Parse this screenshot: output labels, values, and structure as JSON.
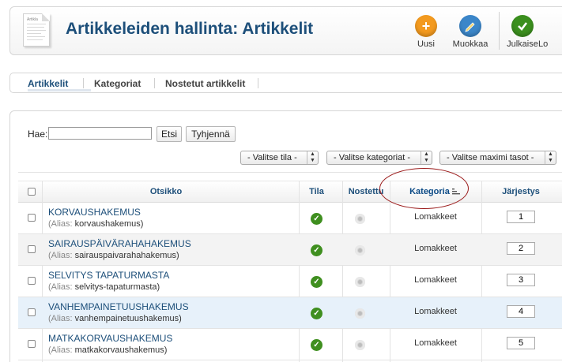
{
  "header": {
    "title": "Artikkeleiden hallinta: Artikkelit",
    "icon_caption": "Artikla",
    "buttons": [
      {
        "label": "Uusi",
        "icon": "plus-icon",
        "color": "#f39a1f"
      },
      {
        "label": "Muokkaa",
        "icon": "pencil-icon",
        "color": "#3b86c9"
      },
      {
        "label": "Julkaise",
        "icon": "check-icon",
        "color": "#3b8f1e"
      },
      {
        "label": "Lo",
        "icon": "",
        "color": ""
      }
    ]
  },
  "submenu": {
    "items": [
      "Artikkelit",
      "Kategoriat",
      "Nostetut artikkelit"
    ]
  },
  "filters": {
    "search_label": "Hae:",
    "search_value": "",
    "search_button": "Etsi",
    "clear_button": "Tyhjennä",
    "state_select": "- Valitse tila -",
    "category_select": "- Valitse kategoriat -",
    "level_select": "- Valitse maximi tasot -"
  },
  "table": {
    "columns": {
      "title": "Otsikko",
      "state": "Tila",
      "featured": "Nostettu",
      "category": "Kategoria",
      "ordering": "Järjestys"
    },
    "alias_prefix": "(Alias:",
    "rows": [
      {
        "title": "KORVAUSHAKEMUS",
        "alias": "korvaushakemus)",
        "category": "Lomakkeet",
        "order": "1"
      },
      {
        "title": "SAIRAUSPÄIVÄRAHAHAKEMUS",
        "alias": "sairauspaivarahahakemus)",
        "category": "Lomakkeet",
        "order": "2"
      },
      {
        "title": "SELVITYS TAPATURMASTA",
        "alias": "selvitys-tapaturmasta)",
        "category": "Lomakkeet",
        "order": "3"
      },
      {
        "title": "VANHEMPAINETUUSHAKEMUS",
        "alias": "vanhempainetuushakemus)",
        "category": "Lomakkeet",
        "order": "4"
      },
      {
        "title": "MATKAKORVAUSHAKEMUS",
        "alias": "matkakorvaushakemus)",
        "category": "Lomakkeet",
        "order": "5"
      }
    ]
  },
  "colors": {
    "title_blue": "#1d4f7a",
    "published_green": "#3f8f1f",
    "highlight_row": "#e7f1fa",
    "annotation_red": "#9b1b1b"
  }
}
